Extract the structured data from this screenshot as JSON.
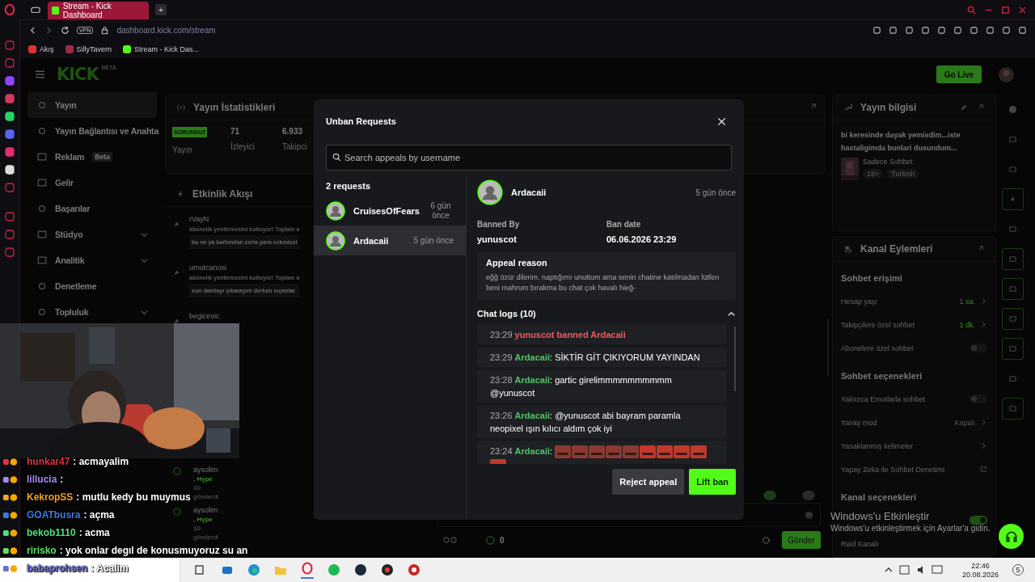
{
  "browser": {
    "tabs": [
      {
        "title": "Stream - Kick Dashboard",
        "selected": true
      }
    ],
    "new_tab": "+",
    "vpn": "VPN",
    "url": {
      "host": "dashboard.kick.com",
      "path": "/stream"
    },
    "bookmarks": [
      {
        "label": "Akış",
        "kind": "fire"
      },
      {
        "label": "SillyTavern",
        "kind": "st"
      },
      {
        "label": "Stream - Kick Das...",
        "kind": "kick"
      }
    ]
  },
  "header": {
    "logo": "KICK",
    "logo_badge": "BETA",
    "go_live": "Go Live"
  },
  "nav": {
    "items": [
      {
        "label": "Yayın",
        "selected": true,
        "has_submenu": false
      },
      {
        "label": "Yayın Bağlantısı ve Anahta",
        "selected": false,
        "has_submenu": false
      },
      {
        "label": "Reklam",
        "badge": "Beta",
        "selected": false,
        "has_submenu": false
      },
      {
        "label": "Gelir",
        "selected": false,
        "has_submenu": false
      },
      {
        "label": "Başarılar",
        "selected": false,
        "has_submenu": false
      },
      {
        "label": "Stüdyo",
        "selected": false,
        "has_submenu": true
      },
      {
        "label": "Analitik",
        "selected": false,
        "has_submenu": true
      },
      {
        "label": "Denetleme",
        "selected": false,
        "has_submenu": false
      },
      {
        "label": "Topluluk",
        "selected": false,
        "has_submenu": true
      }
    ]
  },
  "stats": {
    "title": "Yayın İstatistikleri",
    "items": [
      {
        "kind": "badge",
        "value": "SORUNSUZ",
        "label": "Yayın"
      },
      {
        "kind": "number",
        "value": "71",
        "label": "İzleyici"
      },
      {
        "kind": "number",
        "value": "6.933",
        "label": "Takipci"
      }
    ]
  },
  "activity": {
    "title": "Etkinlik Akışı",
    "events": [
      {
        "user": "rVayN",
        "text": "abonelik yenilemesini kutluyor! Toplam a",
        "message": "bu ne ya kartımdan zorla para cekmissi"
      },
      {
        "user": "umutcanosi",
        "text": "abonelik yenilemesini kutluyor! Toplam a",
        "message": "son damlayı çıkarayım derken sıçanlar"
      },
      {
        "user": "begicevic"
      }
    ],
    "gifts": [
      {
        "user": "aysolim",
        "tier": ", Hype",
        "amount": "10",
        "note": "gönderdi"
      },
      {
        "user": "aysolim",
        "tier": ", Hype",
        "amount": "10",
        "note": "gönderdi"
      }
    ]
  },
  "chat": {
    "count": "0",
    "send": "Gönder"
  },
  "stream_info": {
    "title": "Yayın bilgisi",
    "description": "bi keresinde dayak yemisdim...iste hastaligimda bunlari dusundum...",
    "category": "Sadece Sohbet",
    "tags": [
      "18+",
      "Turkish"
    ]
  },
  "channel_actions": {
    "title": "Kanal Eylemleri",
    "sections": [
      {
        "title": "Sohbet erişimi",
        "rows": [
          {
            "kind": "value",
            "label": "Hesap yaşı",
            "value": "1 sa."
          },
          {
            "kind": "value",
            "label": "Takipçilere özel sohbet",
            "value": "1 dk."
          },
          {
            "kind": "toggle",
            "label": "Abonelere özel sohbet",
            "on": false
          }
        ]
      },
      {
        "title": "Sohbet seçenekleri",
        "rows": [
          {
            "kind": "toggle",
            "label": "Yalnızca Emotlarla sohbet",
            "on": false
          },
          {
            "kind": "value",
            "label": "Yavaş mod",
            "value": "Kapalı"
          },
          {
            "kind": "value",
            "label": "Yasaklanmış kelimeler"
          },
          {
            "kind": "external",
            "label": "Yapay Zeka ile Sohbet Denetimi"
          }
        ]
      },
      {
        "title": "Kanal seçenekleri",
        "rows": [
          {
            "kind": "toggle",
            "on": true
          },
          {
            "kind": "plain",
            "label": "Raid Kanalı"
          }
        ]
      }
    ]
  },
  "rail": [
    {
      "outlined": false
    },
    {
      "outlined": false
    },
    {
      "outlined": false
    },
    {
      "outlined": true
    },
    {
      "outlined": false
    },
    {
      "outlined": true
    },
    {
      "outlined": true
    },
    {
      "outlined": true
    },
    {
      "outlined": true
    },
    {
      "outlined": false
    },
    {
      "outlined": true
    }
  ],
  "modal": {
    "title": "Unban Requests",
    "search": {
      "placeholder": "Search appeals by username"
    },
    "count": "2 requests",
    "requests": [
      {
        "user": "CruisesOfFears",
        "time": "6 gün önce",
        "selected": false
      },
      {
        "user": "Ardacaii",
        "time": "5 gün önce",
        "selected": true
      }
    ],
    "detail": {
      "user": "Ardacaii",
      "time": "5 gün önce",
      "banned_by_label": "Banned By",
      "banned_by": "yunuscot",
      "ban_date_label": "Ban date",
      "ban_date": "06.06.2026 23:29",
      "reason_title": "Appeal reason",
      "reason": "eğğ özür dilerim. naptığımı unuttum ama senin chatine katılmadan lütfen beni mahrum bırakma bu chat çok havalı hieğ-",
      "logs_title": "Chat logs (10)",
      "logs_expanded": true,
      "logs": [
        {
          "kind": "ban",
          "time": "23:29",
          "text": "yunuscot banned Ardacaii"
        },
        {
          "kind": "message",
          "time": "23:29",
          "user": "Ardacaii",
          "separator": ":",
          "text": "SİKTİR GİT ÇIKIYORUM YAYINDAN"
        },
        {
          "kind": "message",
          "time": "23:28",
          "user": "Ardacaii",
          "separator": ":",
          "text": "gartic girelimmmmmmmmmm @yunuscot"
        },
        {
          "kind": "message",
          "time": "23:26",
          "user": "Ardacaii",
          "separator": ":",
          "text": "@yunuscot abi bayram paramla neopixel ışın kılıcı aldım çok iyi"
        },
        {
          "kind": "emotes",
          "time": "23:24",
          "user": "Ardacaii",
          "separator": ":"
        }
      ]
    },
    "buttons": [
      {
        "kind": "secondary",
        "label": "Reject appeal"
      },
      {
        "kind": "primary",
        "label": "Lift ban"
      }
    ]
  },
  "overlay_chat": [
    {
      "user": "hunkar47",
      "color": "#e0334a",
      "message": ": acmayalim"
    },
    {
      "user": "lillucia",
      "color": "#a58bf0",
      "message": ":"
    },
    {
      "user": "KekropSS",
      "color": "#f0a02a",
      "message": ": mutlu kedy bu muymus"
    },
    {
      "user": "GOATbusra",
      "color": "#3b7be0",
      "message": ": açma"
    },
    {
      "user": "bekob1110",
      "color": "#4fe07a",
      "message": ": acma"
    },
    {
      "user": "ririsko",
      "color": "#5fe06a",
      "message": ": yok onlar degıl de konusmuyoruz su an"
    },
    {
      "user": "babaprohsen",
      "color": "#6a70c8",
      "message": ": Acalim"
    }
  ],
  "watermark": {
    "title": "Windows'u Etkinleştir",
    "text": "Windows'u etkinleştirmek için Ayarlar'a gidin."
  },
  "taskbar": {
    "time": "22:46",
    "date": "20.08.2026",
    "notifications": "5"
  }
}
